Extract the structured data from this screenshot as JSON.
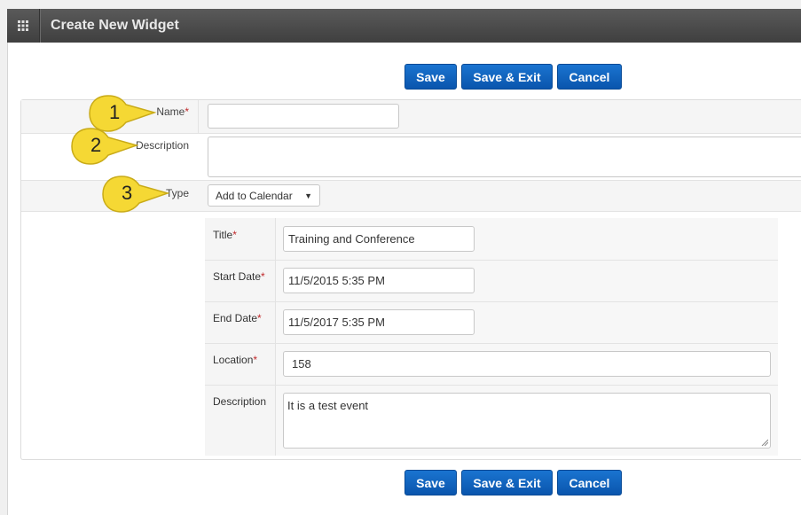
{
  "window": {
    "title": "Create New Widget",
    "menu_icon": "grid-icon"
  },
  "toolbar": {
    "save": "Save",
    "save_exit": "Save & Exit",
    "cancel": "Cancel"
  },
  "form": {
    "name": {
      "label": "Name",
      "required": "*",
      "value": ""
    },
    "description": {
      "label": "Description",
      "value": ""
    },
    "type": {
      "label": "Type",
      "selected": "Add to Calendar"
    }
  },
  "calendar": {
    "title": {
      "label": "Title",
      "required": "*",
      "value": "Training and Conference"
    },
    "start_date": {
      "label": "Start Date",
      "required": "*",
      "value": "11/5/2015 5:35 PM"
    },
    "end_date": {
      "label": "End Date",
      "required": "*",
      "value": "11/5/2017 5:35 PM"
    },
    "location": {
      "label": "Location",
      "required": "*",
      "value": "158"
    },
    "description": {
      "label": "Description",
      "value": "It is a test event"
    }
  },
  "callouts": [
    "1",
    "2",
    "3"
  ],
  "colors": {
    "button": "#0a55ad",
    "required": "#c0292b",
    "callout": "#f7dc4a",
    "titlebar": "#444444"
  }
}
